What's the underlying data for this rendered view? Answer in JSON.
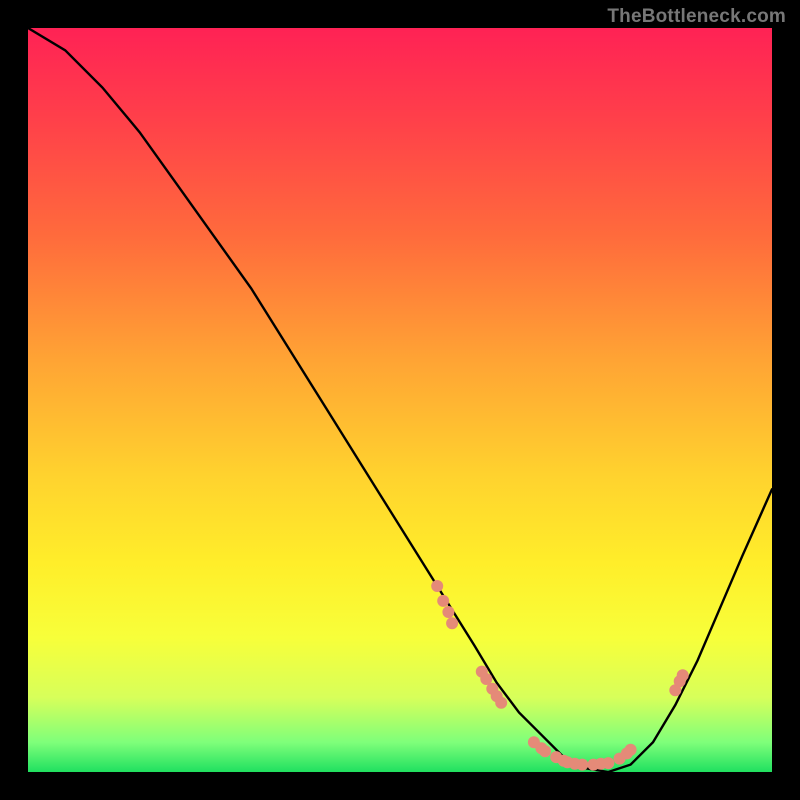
{
  "watermark": "TheBottleneck.com",
  "chart_data": {
    "type": "line",
    "title": "",
    "xlabel": "",
    "ylabel": "",
    "xlim": [
      0,
      100
    ],
    "ylim": [
      0,
      100
    ],
    "series": [
      {
        "name": "bottleneck-curve",
        "x": [
          0,
          5,
          10,
          15,
          20,
          25,
          30,
          35,
          40,
          45,
          50,
          55,
          60,
          63,
          66,
          69,
          72,
          75,
          78,
          81,
          84,
          87,
          90,
          93,
          96,
          100
        ],
        "y": [
          100,
          97,
          92,
          86,
          79,
          72,
          65,
          57,
          49,
          41,
          33,
          25,
          17,
          12,
          8,
          5,
          2,
          0.5,
          0,
          1,
          4,
          9,
          15,
          22,
          29,
          38
        ]
      }
    ],
    "markers": {
      "name": "highlight-dots",
      "color": "#e58a78",
      "points": [
        {
          "x": 55,
          "y": 25
        },
        {
          "x": 55.8,
          "y": 23
        },
        {
          "x": 56.5,
          "y": 21.5
        },
        {
          "x": 57,
          "y": 20
        },
        {
          "x": 61,
          "y": 13.5
        },
        {
          "x": 61.6,
          "y": 12.5
        },
        {
          "x": 62.4,
          "y": 11.2
        },
        {
          "x": 63,
          "y": 10.2
        },
        {
          "x": 63.6,
          "y": 9.3
        },
        {
          "x": 68,
          "y": 4
        },
        {
          "x": 69,
          "y": 3.2
        },
        {
          "x": 69.5,
          "y": 2.8
        },
        {
          "x": 71,
          "y": 2
        },
        {
          "x": 72,
          "y": 1.5
        },
        {
          "x": 72.5,
          "y": 1.3
        },
        {
          "x": 73.5,
          "y": 1.1
        },
        {
          "x": 74.5,
          "y": 1
        },
        {
          "x": 76,
          "y": 1
        },
        {
          "x": 77,
          "y": 1.1
        },
        {
          "x": 78,
          "y": 1.2
        },
        {
          "x": 79.5,
          "y": 1.8
        },
        {
          "x": 80.5,
          "y": 2.5
        },
        {
          "x": 81,
          "y": 3
        },
        {
          "x": 87,
          "y": 11
        },
        {
          "x": 87.6,
          "y": 12.2
        },
        {
          "x": 88,
          "y": 13
        }
      ]
    }
  }
}
